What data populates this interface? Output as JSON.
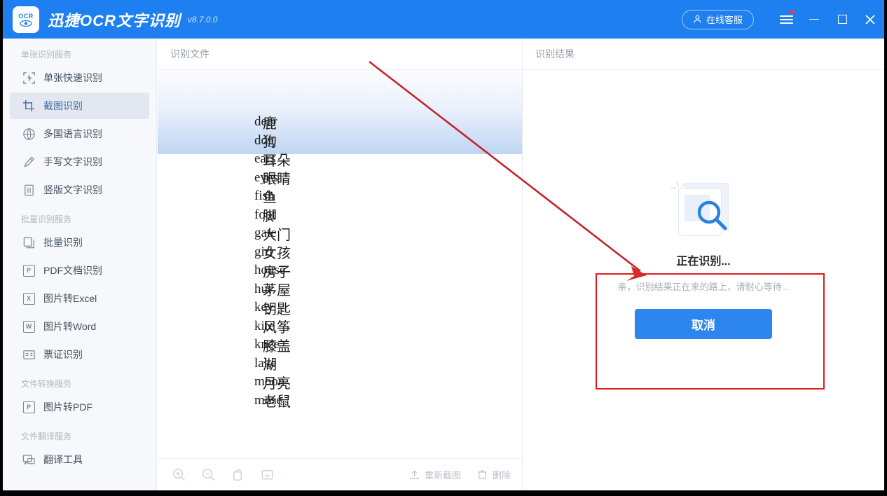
{
  "titlebar": {
    "logo_text": "OCR",
    "app_name": "迅捷OCR文字识别",
    "version": "v8.7.0.0",
    "service_button": "在线客服",
    "menu_icon": "hamburger-menu-icon",
    "minimize_icon": "minimize-icon",
    "maximize_icon": "maximize-icon",
    "close_icon": "close-icon",
    "bg_color": "#1d7ff0"
  },
  "sidebar": {
    "sections": [
      {
        "title": "单张识别服务",
        "items": [
          {
            "label": "单张快速识别",
            "icon": "single-quick-scan-icon",
            "active": false
          },
          {
            "label": "截图识别",
            "icon": "crop-capture-icon",
            "active": true
          },
          {
            "label": "多国语言识别",
            "icon": "globe-icon",
            "active": false
          },
          {
            "label": "手写文字识别",
            "icon": "pen-icon",
            "active": false
          },
          {
            "label": "竖版文字识别",
            "icon": "vertical-text-icon",
            "active": false
          }
        ]
      },
      {
        "title": "批量识别服务",
        "items": [
          {
            "label": "批量识别",
            "icon": "stacked-pages-icon",
            "active": false
          },
          {
            "label": "PDF文档识别",
            "icon": "pdf-file-icon",
            "active": false
          },
          {
            "label": "图片转Excel",
            "icon": "excel-file-icon",
            "active": false
          },
          {
            "label": "图片转Word",
            "icon": "word-file-icon",
            "active": false
          },
          {
            "label": "票证识别",
            "icon": "id-card-icon",
            "active": false
          }
        ]
      },
      {
        "title": "文件转换服务",
        "items": [
          {
            "label": "图片转PDF",
            "icon": "pdf-file-icon",
            "active": false
          }
        ]
      },
      {
        "title": "文件翻译服务",
        "items": [
          {
            "label": "翻译工具",
            "icon": "translate-icon",
            "active": false
          }
        ]
      }
    ]
  },
  "center_panel": {
    "header": "识别文件",
    "word_list": [
      {
        "en": "deer",
        "zh": "鹿",
        "highlighted": true
      },
      {
        "en": "dog",
        "zh": "狗",
        "highlighted": true
      },
      {
        "en": "ears",
        "zh": "耳朵",
        "highlighted": false
      },
      {
        "en": "eyes",
        "zh": "眼睛",
        "highlighted": false
      },
      {
        "en": "fish",
        "zh": "鱼",
        "highlighted": false
      },
      {
        "en": "foot",
        "zh": "脚",
        "highlighted": false
      },
      {
        "en": "gate",
        "zh": "大门",
        "highlighted": false
      },
      {
        "en": "girl",
        "zh": "女孩",
        "highlighted": false
      },
      {
        "en": "house",
        "zh": "房子",
        "highlighted": false
      },
      {
        "en": "hut",
        "zh": "茅屋",
        "highlighted": false
      },
      {
        "en": "key",
        "zh": "钥匙",
        "highlighted": false
      },
      {
        "en": "kite",
        "zh": "风筝",
        "highlighted": false
      },
      {
        "en": "knee",
        "zh": "膝盖",
        "highlighted": false
      },
      {
        "en": "lake",
        "zh": "湖",
        "highlighted": false
      },
      {
        "en": "moon",
        "zh": "月亮",
        "highlighted": false
      },
      {
        "en": "mose",
        "zh": "老鼠",
        "highlighted": false
      }
    ],
    "toolbar": {
      "zoom_in_icon": "zoom-in-icon",
      "zoom_out_icon": "zoom-out-icon",
      "rotate_icon": "rotate-icon",
      "fit_icon": "fit-to-screen-icon",
      "recapture_label": "重新截图",
      "recapture_icon": "upload-icon",
      "delete_label": "删除",
      "delete_icon": "trash-icon"
    }
  },
  "right_panel": {
    "header": "识别结果",
    "status_icon": "document-search-icon",
    "status_title": "正在识别...",
    "status_subtitle": "亲，识别结果正在来的路上，请耐心等待...",
    "cancel_label": "取消",
    "cancel_color": "#2d85ef"
  },
  "annotations": {
    "box_color": "#e01b1b",
    "arrow_color": "#c0272d"
  }
}
